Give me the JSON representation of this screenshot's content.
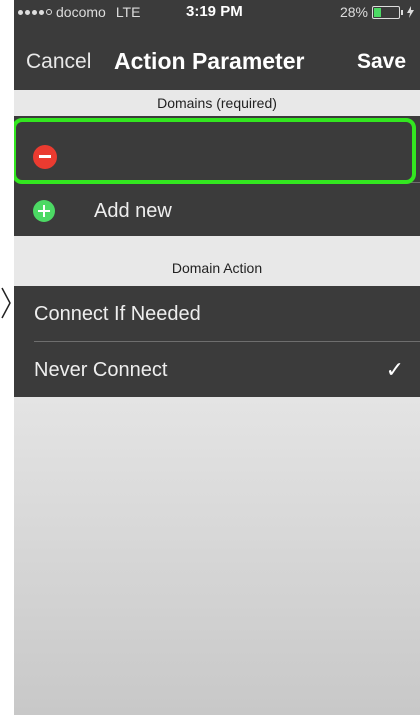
{
  "status_bar": {
    "carrier": "docomo",
    "network": "LTE",
    "time": "3:19 PM",
    "battery": "28%",
    "battery_level": 0.28
  },
  "nav": {
    "cancel_label": "Cancel",
    "title": "Action Parameter",
    "save_label": "Save"
  },
  "domains_section": {
    "header": "Domains (required)",
    "domain_value": "",
    "add_label": "Add new"
  },
  "action_section": {
    "header": "Domain Action",
    "options": [
      {
        "label": "Connect If Needed",
        "selected": false
      },
      {
        "label": "Never Connect",
        "selected": true
      }
    ],
    "checkmark": "✓"
  },
  "colors": {
    "highlight": "#33e620",
    "remove": "#ea3b30",
    "add": "#4cd964"
  }
}
